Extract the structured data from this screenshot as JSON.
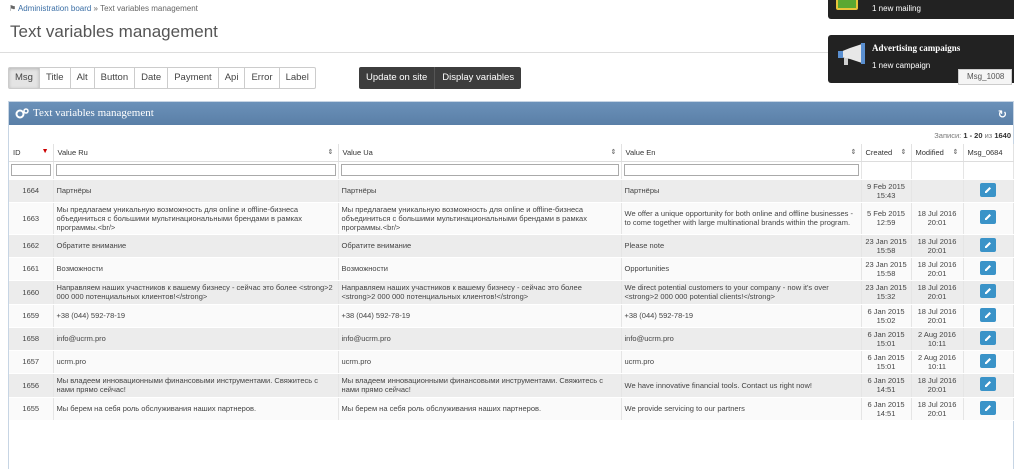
{
  "breadcrumb": {
    "home": "Administration board",
    "separator": " » ",
    "current": "Text variables management"
  },
  "page_title": "Text variables management",
  "tabs": [
    "Msg",
    "Title",
    "Alt",
    "Button",
    "Date",
    "Payment",
    "Api",
    "Error",
    "Label"
  ],
  "active_tab": "Msg",
  "actions": {
    "update": "Update on site",
    "display": "Display variables"
  },
  "notifications": [
    {
      "title": "",
      "text": "1 new mailing"
    },
    {
      "title": "Advertising campaigns",
      "text": "1 new campaign"
    }
  ],
  "search_value": "Msg_1008",
  "panel": {
    "title": "Text variables management"
  },
  "records": {
    "label": "Записи: ",
    "range": "1 - 20",
    "of": " из ",
    "total": "1640"
  },
  "columns": {
    "id": "ID",
    "ru": "Value Ru",
    "ua": "Value Ua",
    "en": "Value En",
    "created": "Created",
    "modified": "Modified",
    "code": "Msg_0684"
  },
  "rows": [
    {
      "id": "1664",
      "ru": "Партнёры",
      "ua": "Партнёры",
      "en": "Партнёры",
      "c1": "9 Feb 2015",
      "c2": "15:43",
      "m1": "",
      "m2": ""
    },
    {
      "id": "1663",
      "ru": "Мы предлагаем уникальную возможность для online и offline-бизнеса объединиться с большими мультинациональными брендами в рамках программы.<br/>",
      "ua": "Мы предлагаем уникальную возможность для online и offline-бизнеса объединиться с большими мультинациональными брендами в рамках программы.<br/>",
      "en": "We offer a unique opportunity for both online and offline businesses - to come together with large multinational brands within the program.",
      "c1": "5 Feb 2015",
      "c2": "12:59",
      "m1": "18 Jul 2016",
      "m2": "20:01"
    },
    {
      "id": "1662",
      "ru": "Обратите внимание",
      "ua": "Обратите внимание",
      "en": "Please note",
      "c1": "23 Jan 2015",
      "c2": "15:58",
      "m1": "18 Jul 2016",
      "m2": "20:01"
    },
    {
      "id": "1661",
      "ru": "Возможности",
      "ua": "Возможности",
      "en": "Opportunities",
      "c1": "23 Jan 2015",
      "c2": "15:58",
      "m1": "18 Jul 2016",
      "m2": "20:01"
    },
    {
      "id": "1660",
      "ru": "Направляем наших участников к вашему бизнесу - сейчас это более <strong>2 000 000 потенциальных клиентов!</strong>",
      "ua": "Направляем наших участников к вашему бизнесу - сейчас это более <strong>2 000 000 потенциальных клиентов!</strong>",
      "en": "We direct potential customers to your company - now it's over <strong>2 000 000 potential clients!</strong>",
      "c1": "23 Jan 2015",
      "c2": "15:32",
      "m1": "18 Jul 2016",
      "m2": "20:01"
    },
    {
      "id": "1659",
      "ru": "+38 (044) 592-78-19",
      "ua": "+38 (044) 592-78-19",
      "en": "+38 (044) 592-78-19",
      "c1": "6 Jan 2015",
      "c2": "15:02",
      "m1": "18 Jul 2016",
      "m2": "20:01"
    },
    {
      "id": "1658",
      "ru": "info@ucrm.pro",
      "ua": "info@ucrm.pro",
      "en": "info@ucrm.pro",
      "c1": "6 Jan 2015",
      "c2": "15:01",
      "m1": "2 Aug 2016",
      "m2": "10:11"
    },
    {
      "id": "1657",
      "ru": "ucrm.pro",
      "ua": "ucrm.pro",
      "en": "ucrm.pro",
      "c1": "6 Jan 2015",
      "c2": "15:01",
      "m1": "2 Aug 2016",
      "m2": "10:11"
    },
    {
      "id": "1656",
      "ru": "Мы владеем инновационными финансовыми инструментами. Свяжитесь с нами прямо сейчас!",
      "ua": "Мы владеем инновационными финансовыми инструментами. Свяжитесь с нами прямо сейчас!",
      "en": "We have innovative financial tools. Contact us right now!",
      "c1": "6 Jan 2015",
      "c2": "14:51",
      "m1": "18 Jul 2016",
      "m2": "20:01"
    },
    {
      "id": "1655",
      "ru": "Мы берем на себя роль обслуживания наших партнеров.",
      "ua": "Мы берем на себя роль обслуживания наших партнеров.",
      "en": "We provide servicing to our partners",
      "c1": "6 Jan 2015",
      "c2": "14:51",
      "m1": "18 Jul 2016",
      "m2": "20:01"
    }
  ]
}
